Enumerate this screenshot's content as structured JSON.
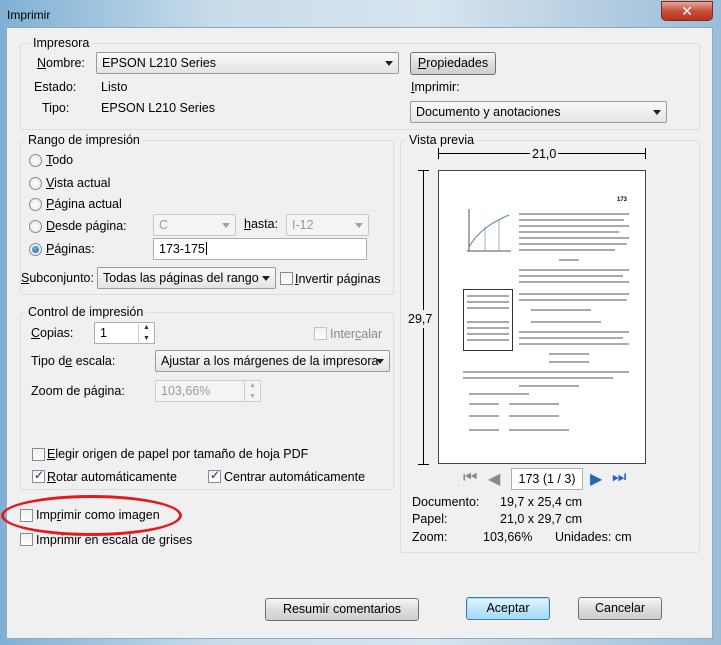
{
  "window": {
    "title": "Imprimir",
    "close_symbol": "✕"
  },
  "printer": {
    "group_label": "Impresora",
    "name_label": "Nombre:",
    "name_value": "EPSON L210 Series",
    "properties_button": "Propiedades",
    "status_label": "Estado:",
    "status_value": "Listo",
    "type_label": "Tipo:",
    "type_value": "EPSON L210 Series",
    "print_label": "Imprimir:",
    "print_value": "Documento y anotaciones"
  },
  "range": {
    "group_label": "Rango de impresión",
    "all": "Todo",
    "current_view": "Vista actual",
    "current_page": "Página actual",
    "from_page": "Desde página:",
    "from_value": "C",
    "to_label": "hasta:",
    "to_value": "I-12",
    "pages": "Páginas:",
    "pages_value": "173-175",
    "subset_label": "Subconjunto:",
    "subset_value": "Todas las páginas del rango",
    "invert_pages": "Invertir páginas"
  },
  "control": {
    "group_label": "Control de impresión",
    "copies_label": "Copias:",
    "copies_value": "1",
    "collate": "Intercalar",
    "scale_type_label": "Tipo de escala:",
    "scale_type_value": "Ajustar a los márgenes de la impresora",
    "zoom_label": "Zoom de página:",
    "zoom_value": "103,66%",
    "paper_source": "Elegir origen de papel por tamaño de hoja PDF",
    "auto_rotate": "Rotar automáticamente",
    "auto_center": "Centrar automáticamente"
  },
  "options": {
    "print_as_image": "Imprimir como imagen",
    "print_grayscale": "Imprimir en escala de grises"
  },
  "preview": {
    "group_label": "Vista previa",
    "width_label": "21,0",
    "height_label": "29,7",
    "page_indicator": "173 (1 / 3)",
    "document_label": "Documento:",
    "document_value": "19,7 x 25,4 cm",
    "paper_label": "Papel:",
    "paper_value": "21,0 x 29,7 cm",
    "zoom_label": "Zoom:",
    "zoom_value": "103,66%",
    "units_label": "Unidades:",
    "units_value": "cm",
    "page_number": "173"
  },
  "buttons": {
    "summarize": "Resumir comentarios",
    "accept": "Aceptar",
    "cancel": "Cancelar"
  },
  "colors": {
    "annotation_red": "#e31b1b",
    "accent_blue": "#2a66b8"
  }
}
